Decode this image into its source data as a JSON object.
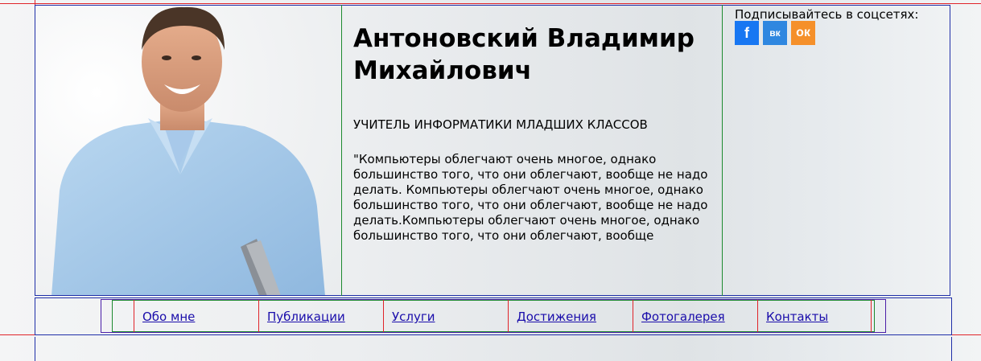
{
  "header": {
    "name": "Антоновский Владимир Михайлович",
    "role": "УЧИТЕЛЬ ИНФОРМАТИКИ МЛАДШИХ КЛАССОВ",
    "quote": "\"Компьютеры облегчают очень многое, однако большинство того, что они облегчают, вообще не надо делать. Компьютеры облегчают очень многое, однако большинство того, что они облегчают, вообще не надо делать.Компьютеры облегчают очень многое, однако большинство того, что они облегчают, вообще"
  },
  "social": {
    "caption": "Подписывайтесь в соцсетях:",
    "links": [
      {
        "icon": "facebook-icon",
        "glyph": "f",
        "color": "#1877f2"
      },
      {
        "icon": "vk-icon",
        "glyph": "вк",
        "color": "#2f87e0"
      },
      {
        "icon": "odnoklassniki-icon",
        "glyph": "ок",
        "color": "#f5902a"
      }
    ]
  },
  "nav": {
    "items": [
      {
        "label": "Обо мне"
      },
      {
        "label": "Публикации"
      },
      {
        "label": "Услуги"
      },
      {
        "label": "Достижения"
      },
      {
        "label": "Фотогалерея"
      },
      {
        "label": "Контакты"
      }
    ]
  },
  "colors": {
    "link": "#1a0dab",
    "debug_red": "#e0242a",
    "debug_blue": "#1f2fa8",
    "debug_green": "#1d8a2f"
  }
}
